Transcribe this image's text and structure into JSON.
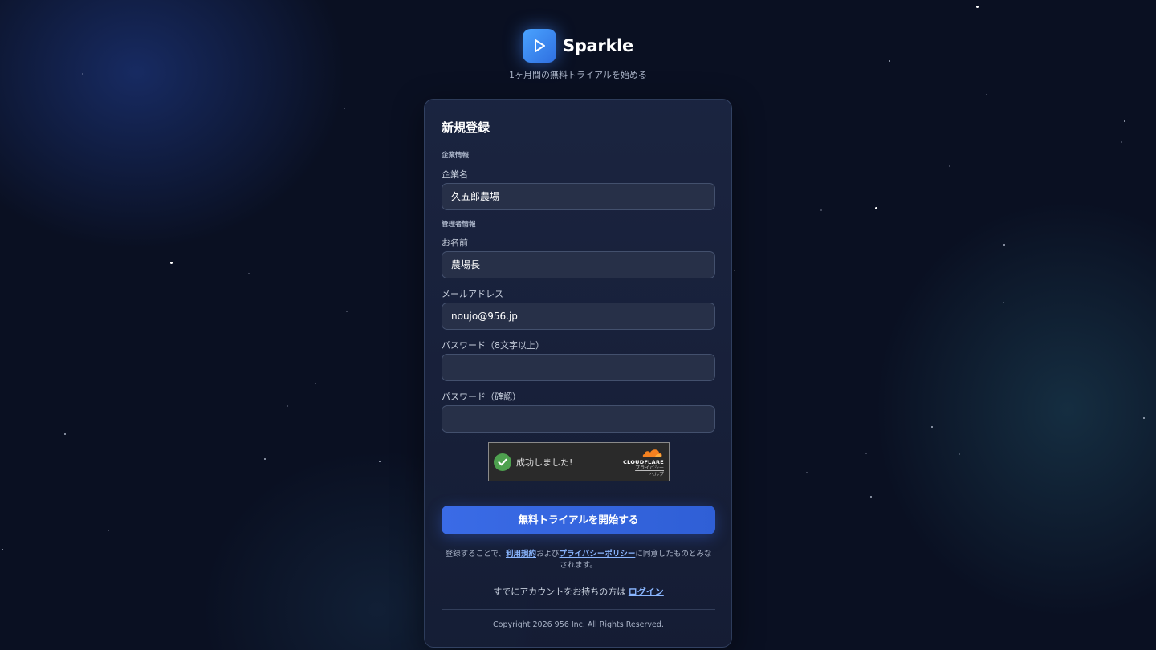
{
  "brand": {
    "name": "Sparkle",
    "tagline": "1ヶ月間の無料トライアルを始める"
  },
  "form": {
    "title": "新規登録",
    "company_section": "企業情報",
    "company_name_label": "企業名",
    "company_name_value": "久五郎農場",
    "admin_section": "管理者情報",
    "name_label": "お名前",
    "name_value": "農場長",
    "email_label": "メールアドレス",
    "email_value": "noujo@956.jp",
    "password_label": "パスワード（8文字以上）",
    "password_value": "",
    "password_confirm_label": "パスワード（確認）",
    "password_confirm_value": ""
  },
  "captcha": {
    "status_text": "成功しました!",
    "provider": "CLOUDFLARE",
    "privacy_link": "プライバシー",
    "help_link": "ヘルプ"
  },
  "submit_label": "無料トライアルを開始する",
  "terms": {
    "prefix": "登録することで、",
    "terms_link": "利用規約",
    "middle": "および",
    "privacy_link": "プライバシーポリシー",
    "suffix": "に同意したものとみなされます。"
  },
  "login": {
    "prompt": "すでにアカウントをお持ちの方は ",
    "link": "ログイン"
  },
  "copyright": "Copyright 2026 956 Inc. All Rights Reserved.",
  "colors": {
    "background": "#0a1022",
    "accent": "#3a6be6",
    "link": "#8ab6ff",
    "success": "#4ea14f"
  }
}
